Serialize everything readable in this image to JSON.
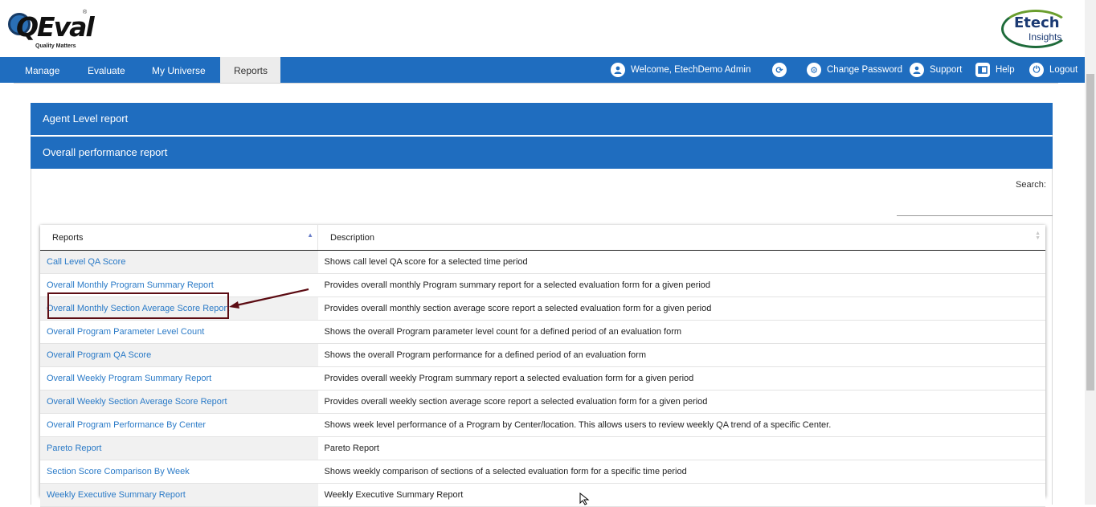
{
  "header": {
    "qeval_logo": {
      "brand": "QEval",
      "tagline": "Quality Matters",
      "mark": "®"
    },
    "etech_logo": {
      "line1": "Etech",
      "line2": "Insights"
    }
  },
  "nav": {
    "items": [
      {
        "label": "Manage"
      },
      {
        "label": "Evaluate"
      },
      {
        "label": "My Universe"
      },
      {
        "label": "Reports",
        "active": true
      }
    ],
    "welcome": "Welcome, EtechDemo Admin",
    "change_password": "Change Password",
    "support": "Support",
    "help": "Help",
    "logout": "Logout"
  },
  "accordion": [
    {
      "label": "Agent Level report"
    },
    {
      "label": "Overall performance report"
    }
  ],
  "search": {
    "label": "Search:",
    "value": ""
  },
  "table": {
    "columns": [
      "Reports",
      "Description"
    ],
    "rows": [
      {
        "report": "Call Level QA Score",
        "description": "Shows call level QA score for a selected time period"
      },
      {
        "report": "Overall Monthly Program Summary Report",
        "description": "Provides overall monthly Program summary report for a selected evaluation form for a given period"
      },
      {
        "report": "Overall Monthly Section Average Score Report",
        "description": "Provides overall monthly section average score report a selected evaluation form for a given period"
      },
      {
        "report": "Overall Program Parameter Level Count",
        "description": "Shows the overall Program parameter level count for a defined period of an evaluation form"
      },
      {
        "report": "Overall Program QA Score",
        "description": "Shows the overall Program performance for a defined period of an evaluation form"
      },
      {
        "report": "Overall Weekly Program Summary Report",
        "description": "Provides overall weekly Program summary report a selected evaluation form for a given period"
      },
      {
        "report": "Overall Weekly Section Average Score Report",
        "description": "Provides overall weekly section average score report a selected evaluation form for a given period"
      },
      {
        "report": "Overall Program Performance By Center",
        "description": "Shows week level performance of a Program by Center/location. This allows users to review weekly QA trend of a specific Center."
      },
      {
        "report": "Pareto Report",
        "description": "Pareto Report"
      },
      {
        "report": "Section Score Comparison By Week",
        "description": "Shows weekly comparison of sections of a selected evaluation form for a specific time period"
      },
      {
        "report": "Weekly Executive Summary Report",
        "description": "Weekly Executive Summary Report"
      }
    ]
  },
  "colors": {
    "primary": "#1f6dbf",
    "link": "#2a7ac7",
    "highlight": "#5c0c13"
  },
  "icons": [
    "user-icon",
    "refresh-icon",
    "gear-icon",
    "support-icon",
    "help-icon",
    "power-icon",
    "sort-asc-icon",
    "sort-both-icon",
    "arrow-annotation-icon"
  ]
}
